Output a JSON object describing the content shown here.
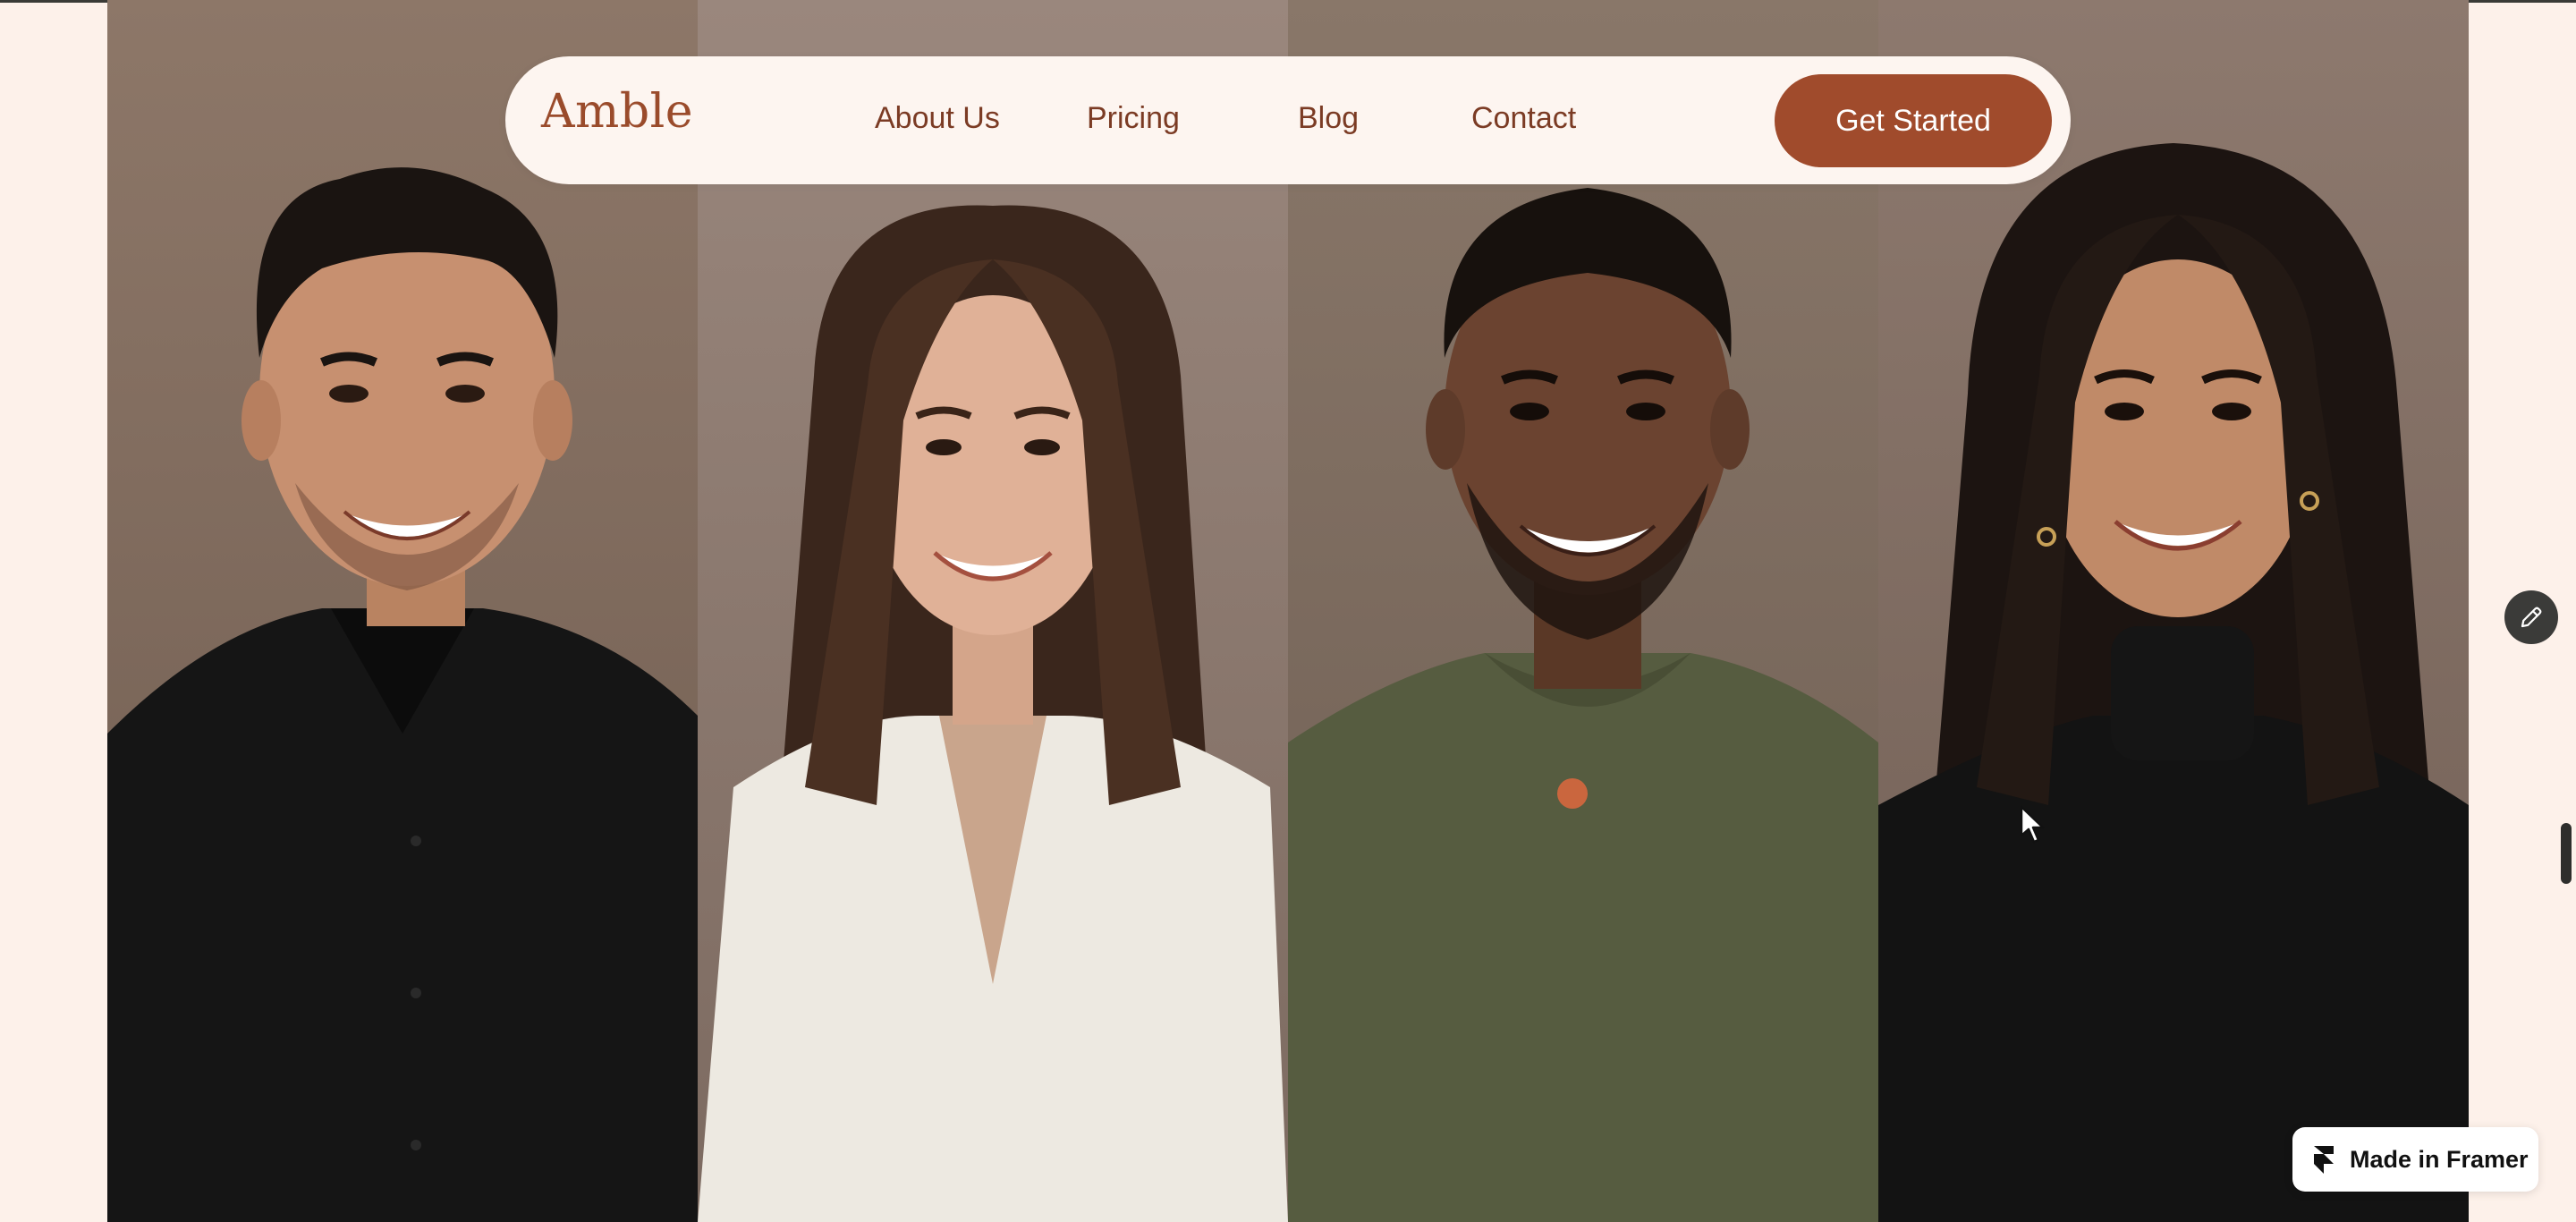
{
  "brand": {
    "name": "Amble",
    "colors": {
      "page_background": "#fdf1ea",
      "nav_background": "#fdf5f0",
      "accent": "#a04b2c",
      "logo_text": "#9a4b2b",
      "nav_text": "#7b3b24",
      "marker": "#d4673e"
    }
  },
  "nav": {
    "links": [
      {
        "label": "About Us"
      },
      {
        "label": "Pricing"
      },
      {
        "label": "Blog"
      },
      {
        "label": "Contact"
      }
    ],
    "cta_label": "Get Started"
  },
  "portraits": [
    {
      "subject": "man-dark-curly-hair-black-shirt",
      "backdrop": "#8a7466",
      "clothing": "#161616"
    },
    {
      "subject": "woman-long-brown-hair-white-blouse",
      "backdrop": "#97837a",
      "clothing": "#f0ede6"
    },
    {
      "subject": "man-short-hair-olive-tshirt",
      "backdrop": "#857468",
      "clothing": "#555b3f"
    },
    {
      "subject": "woman-long-black-hair-black-turtleneck",
      "backdrop": "#8a766c",
      "clothing": "#141414"
    }
  ],
  "floating": {
    "edit_icon": "pencil-icon",
    "framer_badge_label": "Made in Framer",
    "framer_icon": "framer-logo-icon"
  }
}
